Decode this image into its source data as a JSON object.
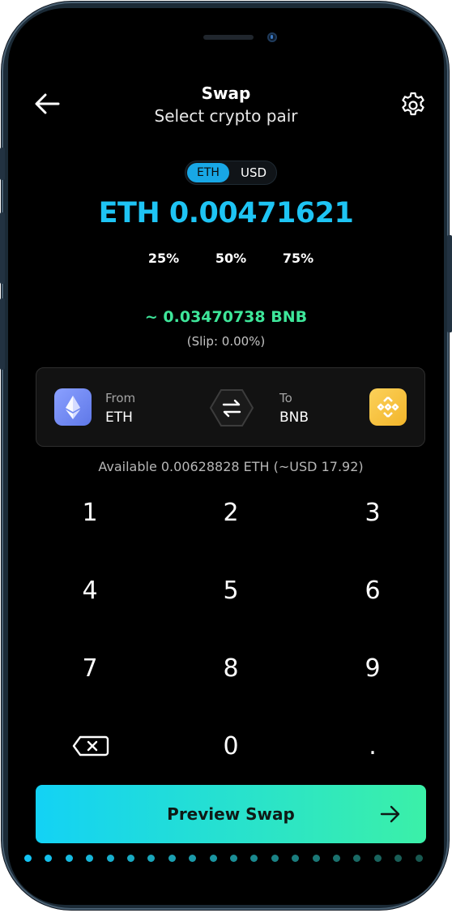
{
  "header": {
    "title": "Swap",
    "subtitle": "Select crypto pair",
    "back_icon": "arrow-left-icon",
    "settings_icon": "gear-icon"
  },
  "toggle": {
    "options": [
      "ETH",
      "USD"
    ],
    "selected": "ETH"
  },
  "amount": "ETH 0.00471621",
  "percent_options": [
    "25%",
    "50%",
    "75%"
  ],
  "estimate": {
    "value": "~ 0.03470738 BNB",
    "slip": "(Slip: 0.00%)"
  },
  "pair": {
    "from_label": "From",
    "from_value": "ETH",
    "to_label": "To",
    "to_value": "BNB",
    "from_icon": "ethereum-icon",
    "to_icon": "binance-icon",
    "swap_icon": "swap-direction-icon"
  },
  "available": "Available 0.00628828 ETH (~USD 17.92)",
  "keypad": {
    "keys": [
      "1",
      "2",
      "3",
      "4",
      "5",
      "6",
      "7",
      "8",
      "9",
      "0",
      "."
    ],
    "delete_icon": "backspace-icon"
  },
  "preview_button": {
    "label": "Preview Swap",
    "icon": "arrow-right-icon"
  },
  "colors": {
    "accent_blue": "#1ec4f4",
    "accent_green": "#3ee69a",
    "button_gradient_start": "#13d2f5",
    "button_gradient_end": "#3bf0a8",
    "eth_coin": "#7a8ff5",
    "bnb_coin": "#f3ba2f"
  }
}
